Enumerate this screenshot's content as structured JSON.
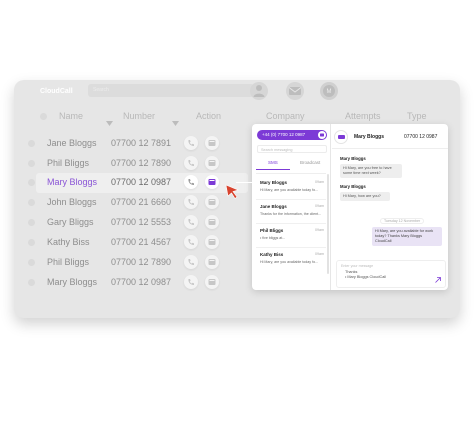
{
  "app": {
    "logo": "CloudCall",
    "search_placeholder": "Search"
  },
  "header": {
    "name": "Name",
    "number": "Number",
    "action": "Action",
    "company": "Company",
    "attempts": "Attempts",
    "type": "Type"
  },
  "contacts": [
    {
      "name": "Jane Bloggs",
      "number": "07700 12 7891"
    },
    {
      "name": "Phil Bliggs",
      "number": "07700 12 7890"
    },
    {
      "name": "Mary Bloggs",
      "number": "07700 12 0987"
    },
    {
      "name": "John Bloggs",
      "number": "07700 21 6660"
    },
    {
      "name": "Gary Bliggs",
      "number": "07700 12 5553"
    },
    {
      "name": "Kathy Biss",
      "number": "07700 21 4567"
    },
    {
      "name": "Phil Bliggs",
      "number": "07700 12 7890"
    },
    {
      "name": "Mary Bloggs",
      "number": "07700 12 0987"
    }
  ],
  "panel": {
    "call_number": "+44 (0) 7700 12 0987",
    "search_placeholder": "Search messaging",
    "tabs": {
      "sms": "SMS",
      "broadcast": "Broadcast"
    },
    "conversations": [
      {
        "name": "Mary Bloggs",
        "time": "09am",
        "preview": "Hi Mary, are you available today fo..."
      },
      {
        "name": "Jane Bloggs",
        "time": "09am",
        "preview": "Thanks for the information, the client..."
      },
      {
        "name": "Phil Bliggs",
        "time": "09am",
        "preview": "• five bliggs at..."
      },
      {
        "name": "Kathy Biss",
        "time": "09am",
        "preview": "Hi Mary, are you available today fo..."
      }
    ],
    "chat": {
      "contact_name": "Mary Bloggs",
      "contact_number": "07700 12 0987",
      "messages": [
        {
          "sender": "Mary Bloggs",
          "text": "Hi Mary, are you free to have some time next week?"
        },
        {
          "sender": "Mary Bloggs",
          "text": "Hi Mary, how are you?"
        }
      ],
      "day": "Tuesday 12 November",
      "my_message": "Hi Mary, are you available for work today? Thanks Mary Bloggs CloudCall",
      "compose_placeholder": "Enter your message",
      "compose_text_1": "Thanks",
      "compose_text_2": "• Mary Bloggs CloudCall"
    }
  },
  "colors": {
    "accent": "#7c3ad6",
    "active_name": "#8a55d6",
    "cursor": "#d8432e"
  }
}
